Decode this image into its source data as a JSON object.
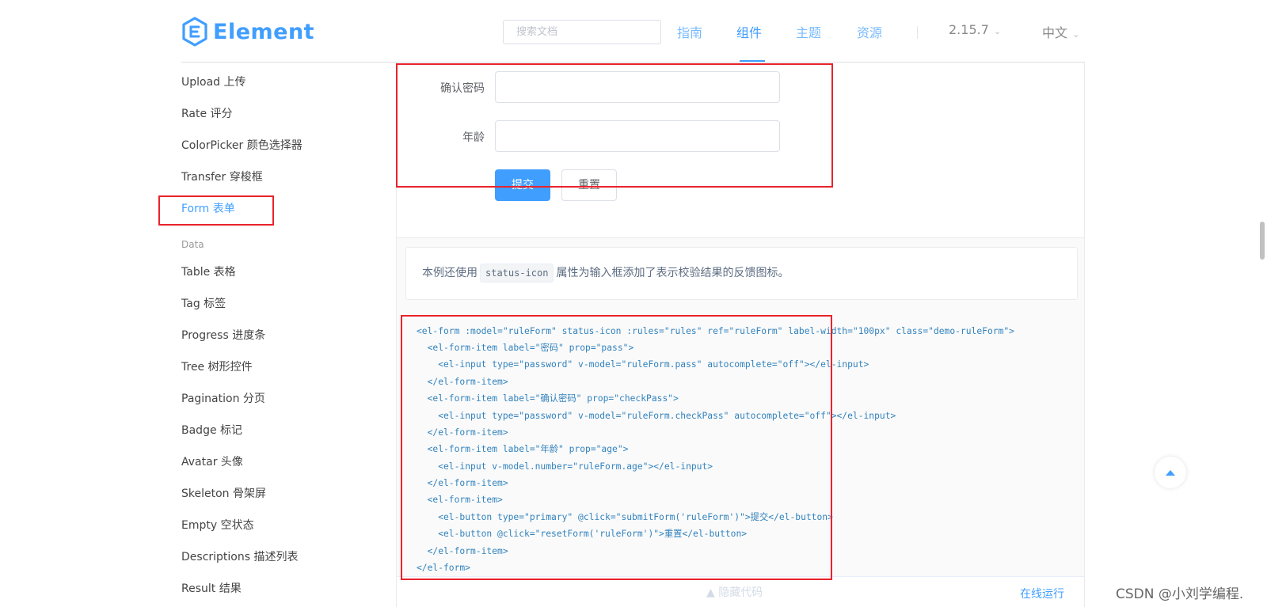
{
  "header": {
    "logo_text": "Element",
    "search_placeholder": "搜索文档",
    "nav": [
      "指南",
      "组件",
      "主题",
      "资源"
    ],
    "version": "2.15.7",
    "language": "中文",
    "accent_color": "#409EFF"
  },
  "sidebar": {
    "items_top": [
      "Upload 上传",
      "Rate 评分",
      "ColorPicker 颜色选择器",
      "Transfer 穿梭框",
      "Form 表单"
    ],
    "active_item": "Form 表单",
    "group_label": "Data",
    "items_data": [
      "Table 表格",
      "Tag 标签",
      "Progress 进度条",
      "Tree 树形控件",
      "Pagination 分页",
      "Badge 标记",
      "Avatar 头像",
      "Skeleton 骨架屏",
      "Empty 空状态",
      "Descriptions 描述列表",
      "Result 结果"
    ]
  },
  "demo": {
    "label_confirm_password": "确认密码",
    "label_age": "年龄",
    "submit_button": "提交",
    "reset_button": "重置"
  },
  "description": {
    "before": "本例还使用",
    "code": "status-icon",
    "after": "属性为输入框添加了表示校验结果的反馈图标。"
  },
  "code_lines": [
    "<el-form :model=\"ruleForm\" status-icon :rules=\"rules\" ref=\"ruleForm\" label-width=\"100px\" class=\"demo-ruleForm\">",
    "  <el-form-item label=\"密码\" prop=\"pass\">",
    "    <el-input type=\"password\" v-model=\"ruleForm.pass\" autocomplete=\"off\"></el-input>",
    "  </el-form-item>",
    "  <el-form-item label=\"确认密码\" prop=\"checkPass\">",
    "    <el-input type=\"password\" v-model=\"ruleForm.checkPass\" autocomplete=\"off\"></el-input>",
    "  </el-form-item>",
    "  <el-form-item label=\"年龄\" prop=\"age\">",
    "    <el-input v-model.number=\"ruleForm.age\"></el-input>",
    "  </el-form-item>",
    "  <el-form-item>",
    "    <el-button type=\"primary\" @click=\"submitForm('ruleForm')\">提交</el-button>",
    "    <el-button @click=\"resetForm('ruleForm')\">重置</el-button>",
    "  </el-form-item>",
    "</el-form>"
  ],
  "controls": {
    "hide_code": "隐藏代码",
    "run_online": "在线运行"
  },
  "watermark": "CSDN @小刘学编程."
}
